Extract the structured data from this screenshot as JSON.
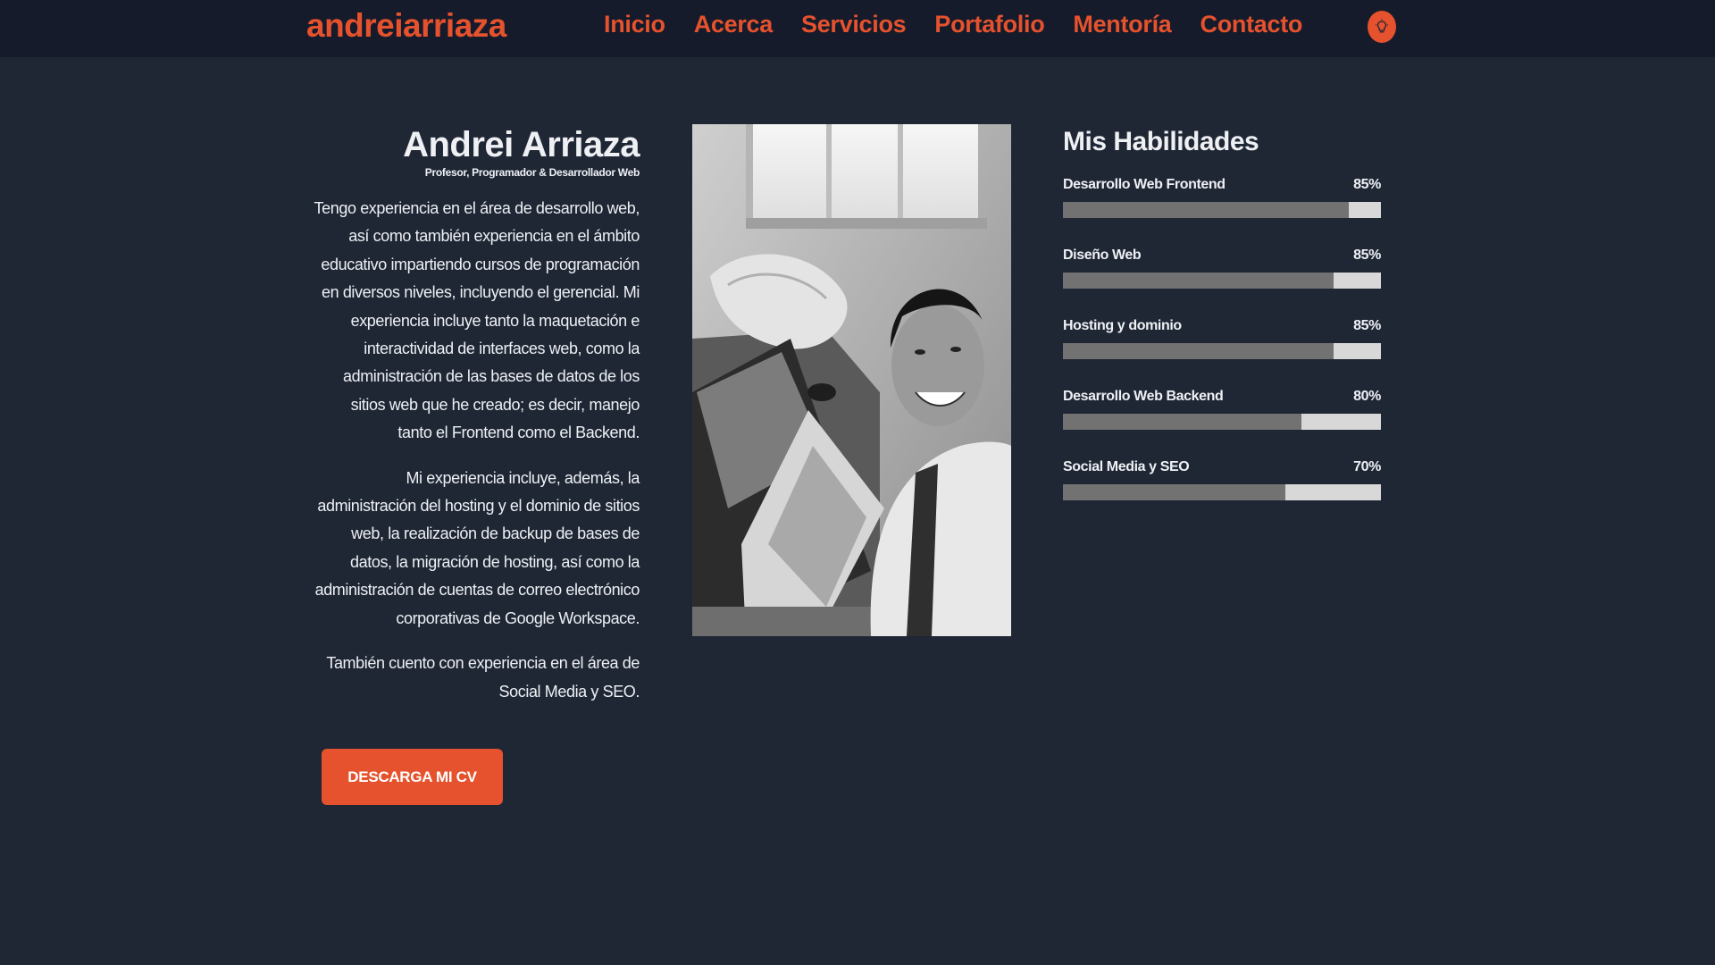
{
  "header": {
    "logo": "andreiarriaza",
    "nav": [
      "Inicio",
      "Acerca",
      "Servicios",
      "Portafolio",
      "Mentoría",
      "Contacto"
    ],
    "theme_icon": "lightbulb-icon"
  },
  "about": {
    "name": "Andrei Arriaza",
    "subtitle": "Profesor, Programador & Desarrollador Web",
    "paragraphs": [
      "Tengo experiencia en el área de desarrollo web, así como también experiencia en el ámbito educativo impartiendo cursos de programación en diversos niveles, incluyendo el gerencial. Mi experiencia incluye tanto la maquetación e interactividad de interfaces web, como la administración de las bases de datos de los sitios web que he creado; es decir, manejo tanto el Frontend como el Backend.",
      "Mi experiencia incluye, además, la administración del hosting y el dominio de sitios web, la realización de backup de bases de datos, la migración de hosting, así como la administración de cuentas de correo electrónico corporativas de Google Workspace.",
      "También cuento con experiencia en el área de Social Media y SEO."
    ],
    "cv_button": "DESCARGA MI CV"
  },
  "skills": {
    "title": "Mis Habilidades",
    "items": [
      {
        "label": "Desarrollo Web Frontend",
        "percent_label": "85%",
        "level": 0.9
      },
      {
        "label": "Diseño Web",
        "percent_label": "85%",
        "level": 0.85
      },
      {
        "label": "Hosting y dominio",
        "percent_label": "85%",
        "level": 0.85
      },
      {
        "label": "Desarrollo Web Backend",
        "percent_label": "80%",
        "level": 0.75
      },
      {
        "label": "Social Media y SEO",
        "percent_label": "70%",
        "level": 0.7
      }
    ]
  },
  "colors": {
    "accent": "#e5522d",
    "background": "#1f2735",
    "header": "#151b2b"
  }
}
